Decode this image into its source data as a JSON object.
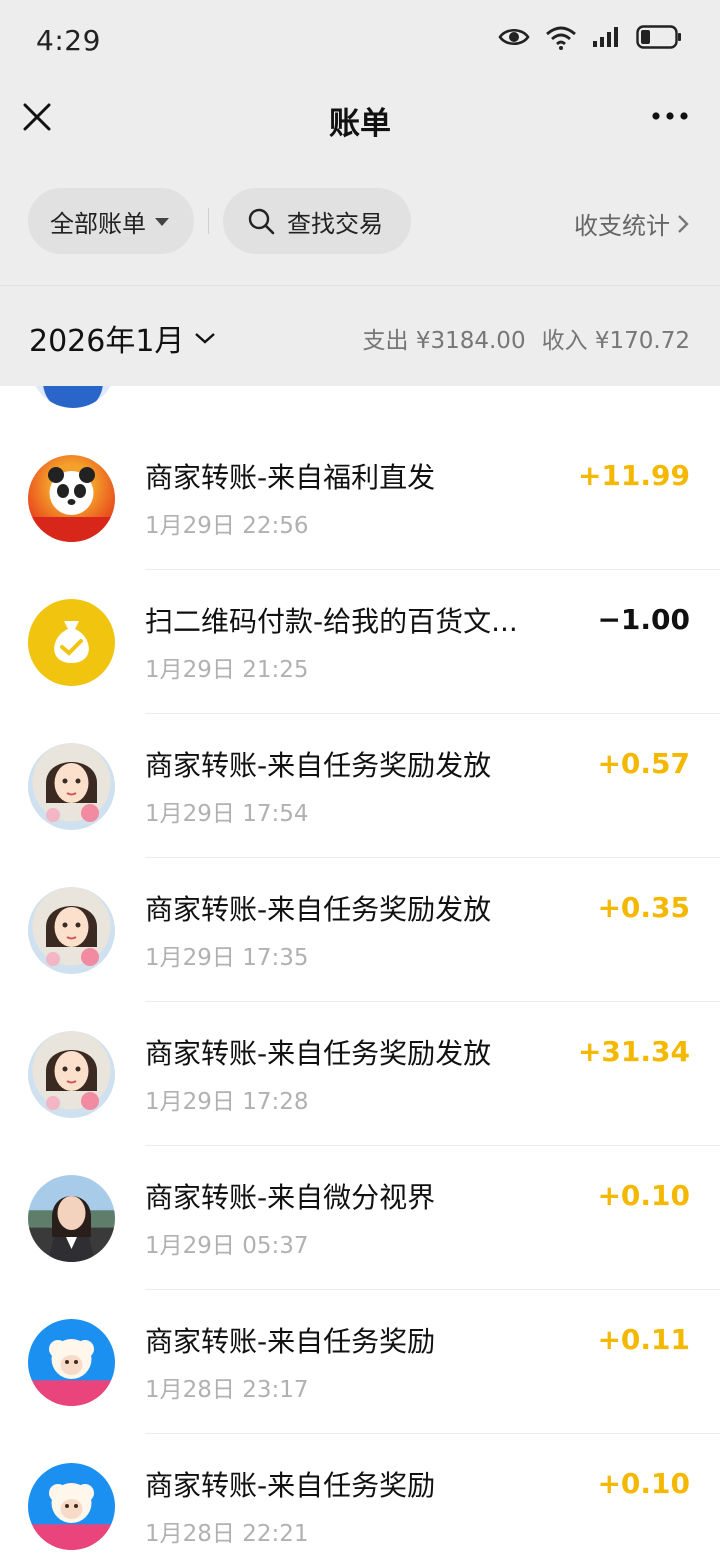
{
  "status_bar": {
    "time": "4:29",
    "icons": [
      "eye-icon",
      "wifi-6-icon",
      "signal-icon",
      "battery-icon"
    ],
    "wifi_badge": "6"
  },
  "nav": {
    "title": "账单",
    "close_icon": "close-icon",
    "more_icon": "more-icon"
  },
  "filters": {
    "all_bills_label": "全部账单",
    "search_label": "查找交易",
    "stats_label": "收支统计"
  },
  "month": {
    "label": "2026年1月",
    "expense": "支出 ¥3184.00",
    "income": "收入 ¥170.72"
  },
  "colors": {
    "background_top": "#ededed",
    "income_amount": "#f5b800",
    "expense_amount": "#111111",
    "time_text": "#b1b1b1"
  },
  "transactions": [
    {
      "title": "商家转账-来自福利直发",
      "time": "1月29日 22:56",
      "amount": "+11.99",
      "type": "income",
      "avatar": "panda-avatar"
    },
    {
      "title": "扫二维码付款-给我的百货文...",
      "time": "1月29日 21:25",
      "amount": "−1.00",
      "type": "expense",
      "avatar": "money-bag-icon"
    },
    {
      "title": "商家转账-来自任务奖励发放",
      "time": "1月29日 17:54",
      "amount": "+0.57",
      "type": "income",
      "avatar": "girl-avatar"
    },
    {
      "title": "商家转账-来自任务奖励发放",
      "time": "1月29日 17:35",
      "amount": "+0.35",
      "type": "income",
      "avatar": "girl-avatar"
    },
    {
      "title": "商家转账-来自任务奖励发放",
      "time": "1月29日 17:28",
      "amount": "+31.34",
      "type": "income",
      "avatar": "girl-avatar"
    },
    {
      "title": "商家转账-来自微分视界",
      "time": "1月29日 05:37",
      "amount": "+0.10",
      "type": "income",
      "avatar": "woman-avatar"
    },
    {
      "title": "商家转账-来自任务奖励",
      "time": "1月28日 23:17",
      "amount": "+0.11",
      "type": "income",
      "avatar": "sheep-avatar"
    },
    {
      "title": "商家转账-来自任务奖励",
      "time": "1月28日 22:21",
      "amount": "+0.10",
      "type": "income",
      "avatar": "sheep-avatar"
    }
  ]
}
